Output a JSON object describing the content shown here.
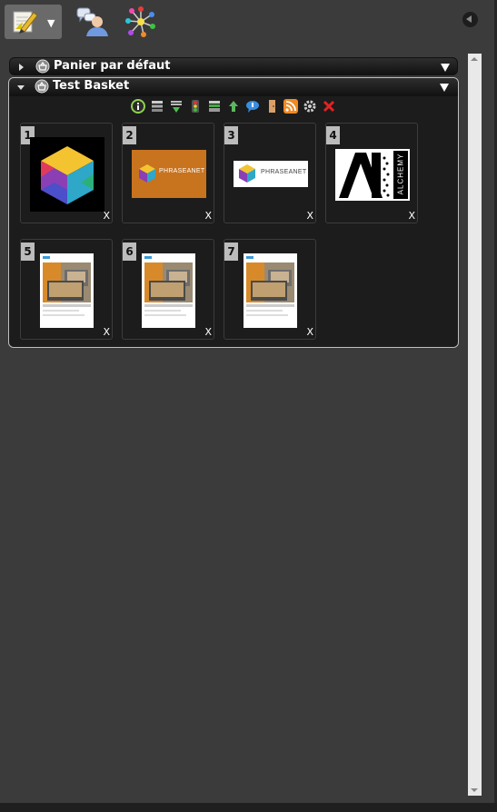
{
  "toolbar": {
    "edit_icon": "edit-pencil-icon",
    "users_icon": "users-chat-icon",
    "spark_icon": "network-star-icon",
    "collapse_icon": "collapse-left-icon"
  },
  "baskets": [
    {
      "title": "Panier par défaut",
      "expanded": false
    },
    {
      "title": "Test Basket",
      "expanded": true
    }
  ],
  "basket_actions": [
    "info-icon",
    "list-icon",
    "download-icon",
    "traffic-light-icon",
    "archive-icon",
    "recycle-icon",
    "chat-bubble-icon",
    "door-icon",
    "rss-icon",
    "settings-icon",
    "delete-icon"
  ],
  "items": [
    {
      "number": "1",
      "remove": "X",
      "kind": "cube"
    },
    {
      "number": "2",
      "remove": "X",
      "kind": "phraseanet-orange",
      "label": "PHRASEANET"
    },
    {
      "number": "3",
      "remove": "X",
      "kind": "phraseanet-white",
      "label": "PHRASEANET"
    },
    {
      "number": "4",
      "remove": "X",
      "kind": "alchemy",
      "label": "ALCHEMY"
    },
    {
      "number": "5",
      "remove": "X",
      "kind": "document"
    },
    {
      "number": "6",
      "remove": "X",
      "kind": "document"
    },
    {
      "number": "7",
      "remove": "X",
      "kind": "document"
    }
  ],
  "colors": {
    "background": "#3b3b3b",
    "panel": "#1c1c1c",
    "orange": "#c8731e"
  }
}
